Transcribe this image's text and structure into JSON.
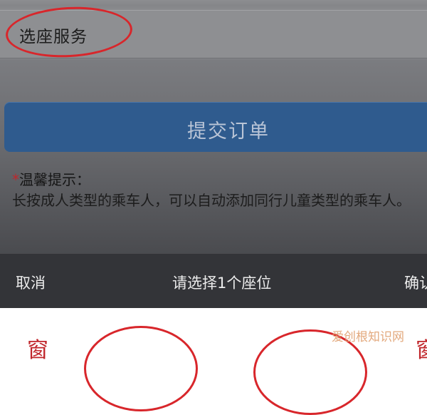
{
  "seat_service": {
    "label": "选座服务"
  },
  "submit": {
    "label": "提交订单"
  },
  "tip": {
    "star": "*",
    "title": "温馨提示：",
    "body": "长按成人类型的乘车人，可以自动添加同行儿童类型的乘车人。"
  },
  "picker": {
    "cancel": "取消",
    "title": "请选择1个座位",
    "confirm": "确认"
  },
  "seats": {
    "left_char": "窗",
    "right_char": "窗"
  },
  "watermark": "爱创根知识网",
  "colors": {
    "accent_red": "#d8262b",
    "submit_blue": "#2f5b8e",
    "toolbar": "#333438"
  }
}
